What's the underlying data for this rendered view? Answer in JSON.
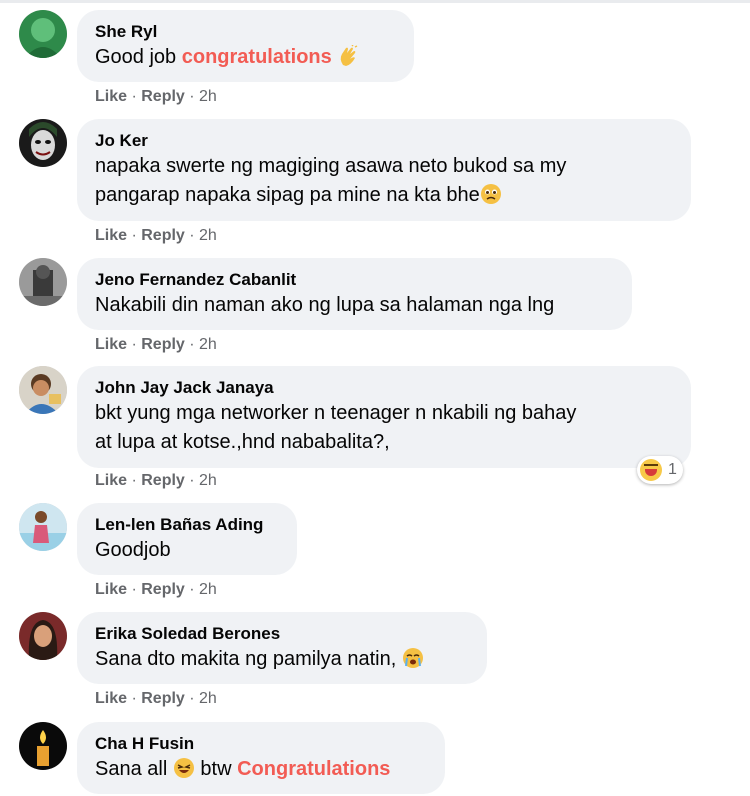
{
  "comments": [
    {
      "author": "She Ryl",
      "text_parts": [
        "Good job ",
        "congratulations"
      ],
      "emoji": "clapping-hands",
      "like": "Like",
      "reply": "Reply",
      "time": "2h"
    },
    {
      "author": "Jo Ker",
      "text_line1": "napaka swerte ng magiging asawa neto bukod sa my",
      "text_line2": "pangarap napaka sipag pa mine na kta bhe",
      "emoji": "crying-face",
      "like": "Like",
      "reply": "Reply",
      "time": "2h"
    },
    {
      "author": "Jeno Fernandez Cabanlit",
      "text": "Nakabili din naman ako ng lupa sa halaman nga lng",
      "like": "Like",
      "reply": "Reply",
      "time": "2h"
    },
    {
      "author": "John Jay Jack Janaya",
      "text_line1": "bkt yung mga networker n teenager n nkabili ng bahay",
      "text_line2": "at lupa at kotse.,hnd nababalita?,",
      "reaction": {
        "type": "haha",
        "count": "1"
      },
      "like": "Like",
      "reply": "Reply",
      "time": "2h"
    },
    {
      "author": "Len-len Bañas Ading",
      "text": "Goodjob",
      "like": "Like",
      "reply": "Reply",
      "time": "2h"
    },
    {
      "author": "Erika Soledad Berones",
      "text": "Sana dto makita ng pamilya natin,",
      "emoji": "crying-face",
      "like": "Like",
      "reply": "Reply",
      "time": "2h"
    },
    {
      "author": "Cha H Fusin",
      "text_parts": [
        "Sana all ",
        " btw ",
        "Congratulations"
      ],
      "emoji": "grinning-sweat-face"
    }
  ],
  "colors": {
    "bubble": "#f0f2f5",
    "highlight": "#f25c54",
    "meta": "#65676b"
  }
}
